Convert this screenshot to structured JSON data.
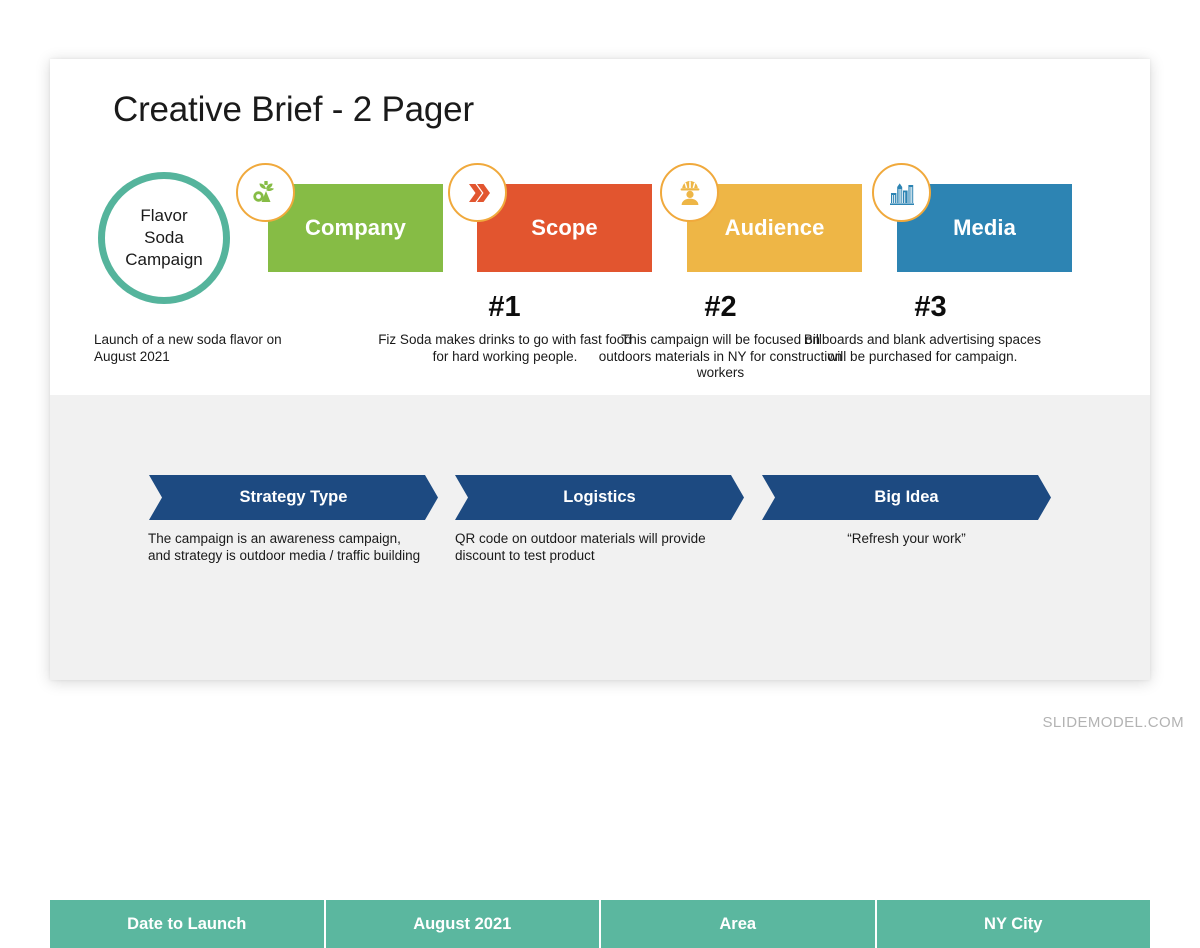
{
  "slide": {
    "title": "Creative Brief - 2 Pager",
    "watermark": "SLIDEMODEL.COM"
  },
  "flavor_circle": {
    "text": "Flavor\nSoda\nCampaign",
    "ring_color": "#55b49c",
    "caption": "Launch of a new soda flavor on August 2021"
  },
  "stages": [
    {
      "label": "Company",
      "color": "#86bc45",
      "icon": "plant-bottle-icon",
      "icon_color": "#86bc45",
      "number": "#1",
      "caption": "Fiz Soda makes drinks to go with fast food for hard working people."
    },
    {
      "label": "Scope",
      "color": "#e2552f",
      "icon": "double-chevron-right-icon",
      "icon_color": "#e2552f",
      "number": "#2",
      "caption": "This campaign will be focused on outdoors materials in NY for construction workers"
    },
    {
      "label": "Audience",
      "color": "#eeb646",
      "icon": "construction-worker-icon",
      "icon_color": "#eeb646",
      "number": "#3",
      "caption": "Billboards and blank advertising spaces will be purchased for campaign."
    },
    {
      "label": "Media",
      "color": "#2d84b3",
      "icon": "city-buildings-icon",
      "icon_color": "#2d84b3",
      "number": "",
      "caption": ""
    }
  ],
  "chevrons": [
    {
      "label": "Strategy Type",
      "color": "#1d4a81",
      "caption": "The campaign is an awareness campaign, and strategy is outdoor media / traffic building"
    },
    {
      "label": "Logistics",
      "color": "#1d4a81",
      "caption": "QR code on outdoor materials will provide discount to test product"
    },
    {
      "label": "Big Idea",
      "color": "#1d4a81",
      "caption": "“Refresh your work”"
    }
  ],
  "footer_table": {
    "color": "#5bb79f",
    "cells": [
      {
        "label": "Date to Launch"
      },
      {
        "label": "August 2021"
      },
      {
        "label": "Area"
      },
      {
        "label": "NY City"
      }
    ]
  }
}
